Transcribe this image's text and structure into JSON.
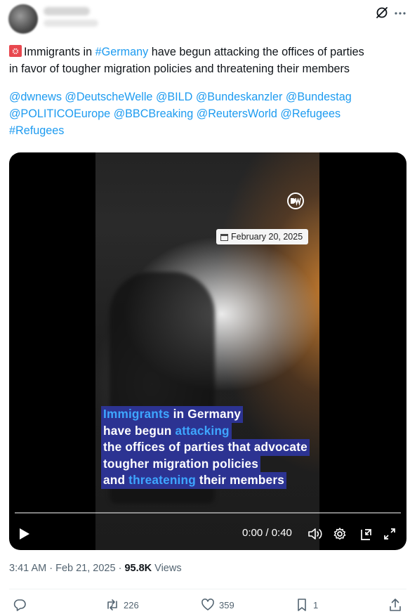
{
  "tweet": {
    "segments_line1": {
      "part1": "Immigrants in ",
      "hashtag_germany": "#Germany",
      "part2": " have begun attacking the offices of parties"
    },
    "line2": "in favor of tougher migration policies and threatening their members",
    "mentions_line1": [
      "@dwnews",
      "@DeutscheWelle",
      "@BILD",
      "@Bundeskanzler",
      "@Bundestag"
    ],
    "mentions_line2": [
      "@POLITICOEurope",
      "@BBCBreaking",
      "@ReutersWorld",
      "@Refugees"
    ],
    "hashtag_refugees": "#Refugees"
  },
  "video": {
    "date_stamp": "February 20, 2025",
    "caption": {
      "l1_hl": "Immigrants",
      "l1_rest": " in Germany",
      "l2_pre": "have begun ",
      "l2_hl": "attacking",
      "l3": "the offices of parties that advocate",
      "l4": "tougher migration policies",
      "l5_pre": "and ",
      "l5_hl": "threatening",
      "l5_rest": " their members"
    },
    "time": "0:00 / 0:40",
    "progress": 0.0
  },
  "meta": {
    "timestamp": "3:41 AM · Feb 21, 2025 · ",
    "views_count": "95.8K",
    "views_label": " Views"
  },
  "actions": {
    "reposts": "226",
    "likes": "359",
    "bookmarks": "1"
  },
  "colors": {
    "link": "#1d9bf0",
    "caption_bg": "#2c3392",
    "caption_highlight": "#3ea6ff"
  }
}
